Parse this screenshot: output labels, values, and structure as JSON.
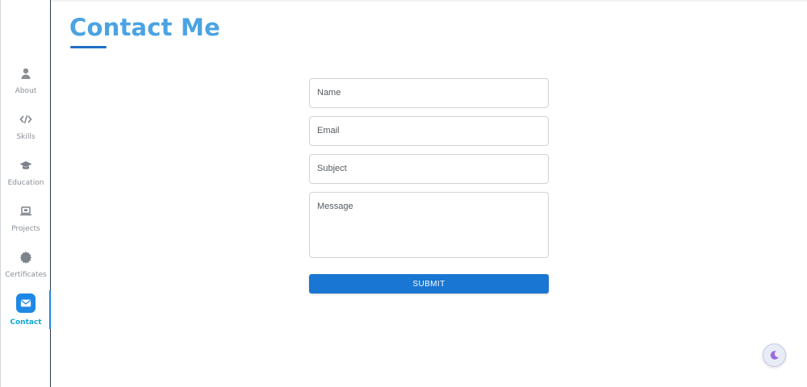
{
  "title": "Contact Me",
  "colors": {
    "accent": "#1e88e5",
    "title": "#4ba3e3",
    "active_label": "#12a6d6",
    "submit": "#1976d2"
  },
  "sidebar": {
    "items": [
      {
        "label": "About",
        "icon": "user-icon"
      },
      {
        "label": "Skills",
        "icon": "code-icon"
      },
      {
        "label": "Education",
        "icon": "graduation-cap-icon"
      },
      {
        "label": "Projects",
        "icon": "laptop-icon"
      },
      {
        "label": "Certificates",
        "icon": "certificate-icon"
      },
      {
        "label": "Contact",
        "icon": "envelope-icon",
        "active": true
      }
    ]
  },
  "form": {
    "name_placeholder": "Name",
    "email_placeholder": "Email",
    "subject_placeholder": "Subject",
    "message_placeholder": "Message",
    "submit_label": "SUBMIT"
  },
  "theme_toggle": {
    "icon": "moon-icon"
  }
}
